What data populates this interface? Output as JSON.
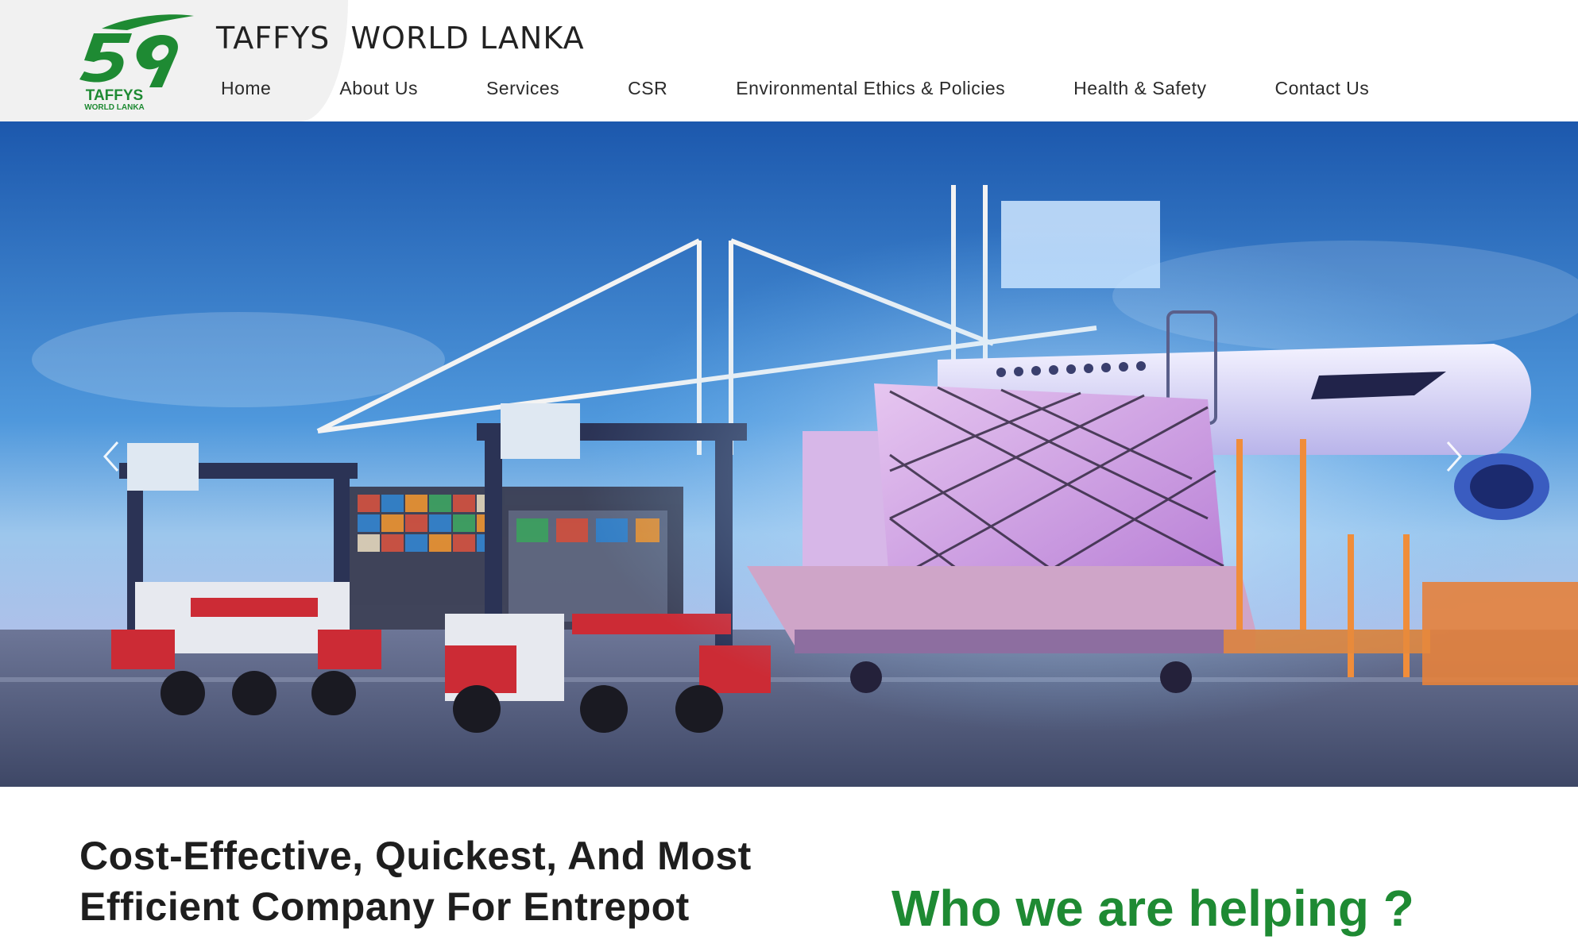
{
  "brand": {
    "logo_mark": "59",
    "logo_name": "TAFFYS",
    "logo_sub": "WORLD LANKA",
    "title": "TAFFYS  WORLD LANKA",
    "accent": "#1e8a33"
  },
  "nav": {
    "items": [
      {
        "label": "Home"
      },
      {
        "label": "About Us"
      },
      {
        "label": "Services"
      },
      {
        "label": "CSR"
      },
      {
        "label": "Environmental Ethics & Policies"
      },
      {
        "label": "Health & Safety"
      },
      {
        "label": "Contact Us"
      }
    ]
  },
  "hero": {
    "prev_icon": "chevron-left-icon",
    "next_icon": "chevron-right-icon"
  },
  "intro": {
    "heading": "Cost-Effective, Quickest, And Most Efficient Company For Entrepot"
  },
  "helping": {
    "heading": "Who we are helping ?"
  }
}
